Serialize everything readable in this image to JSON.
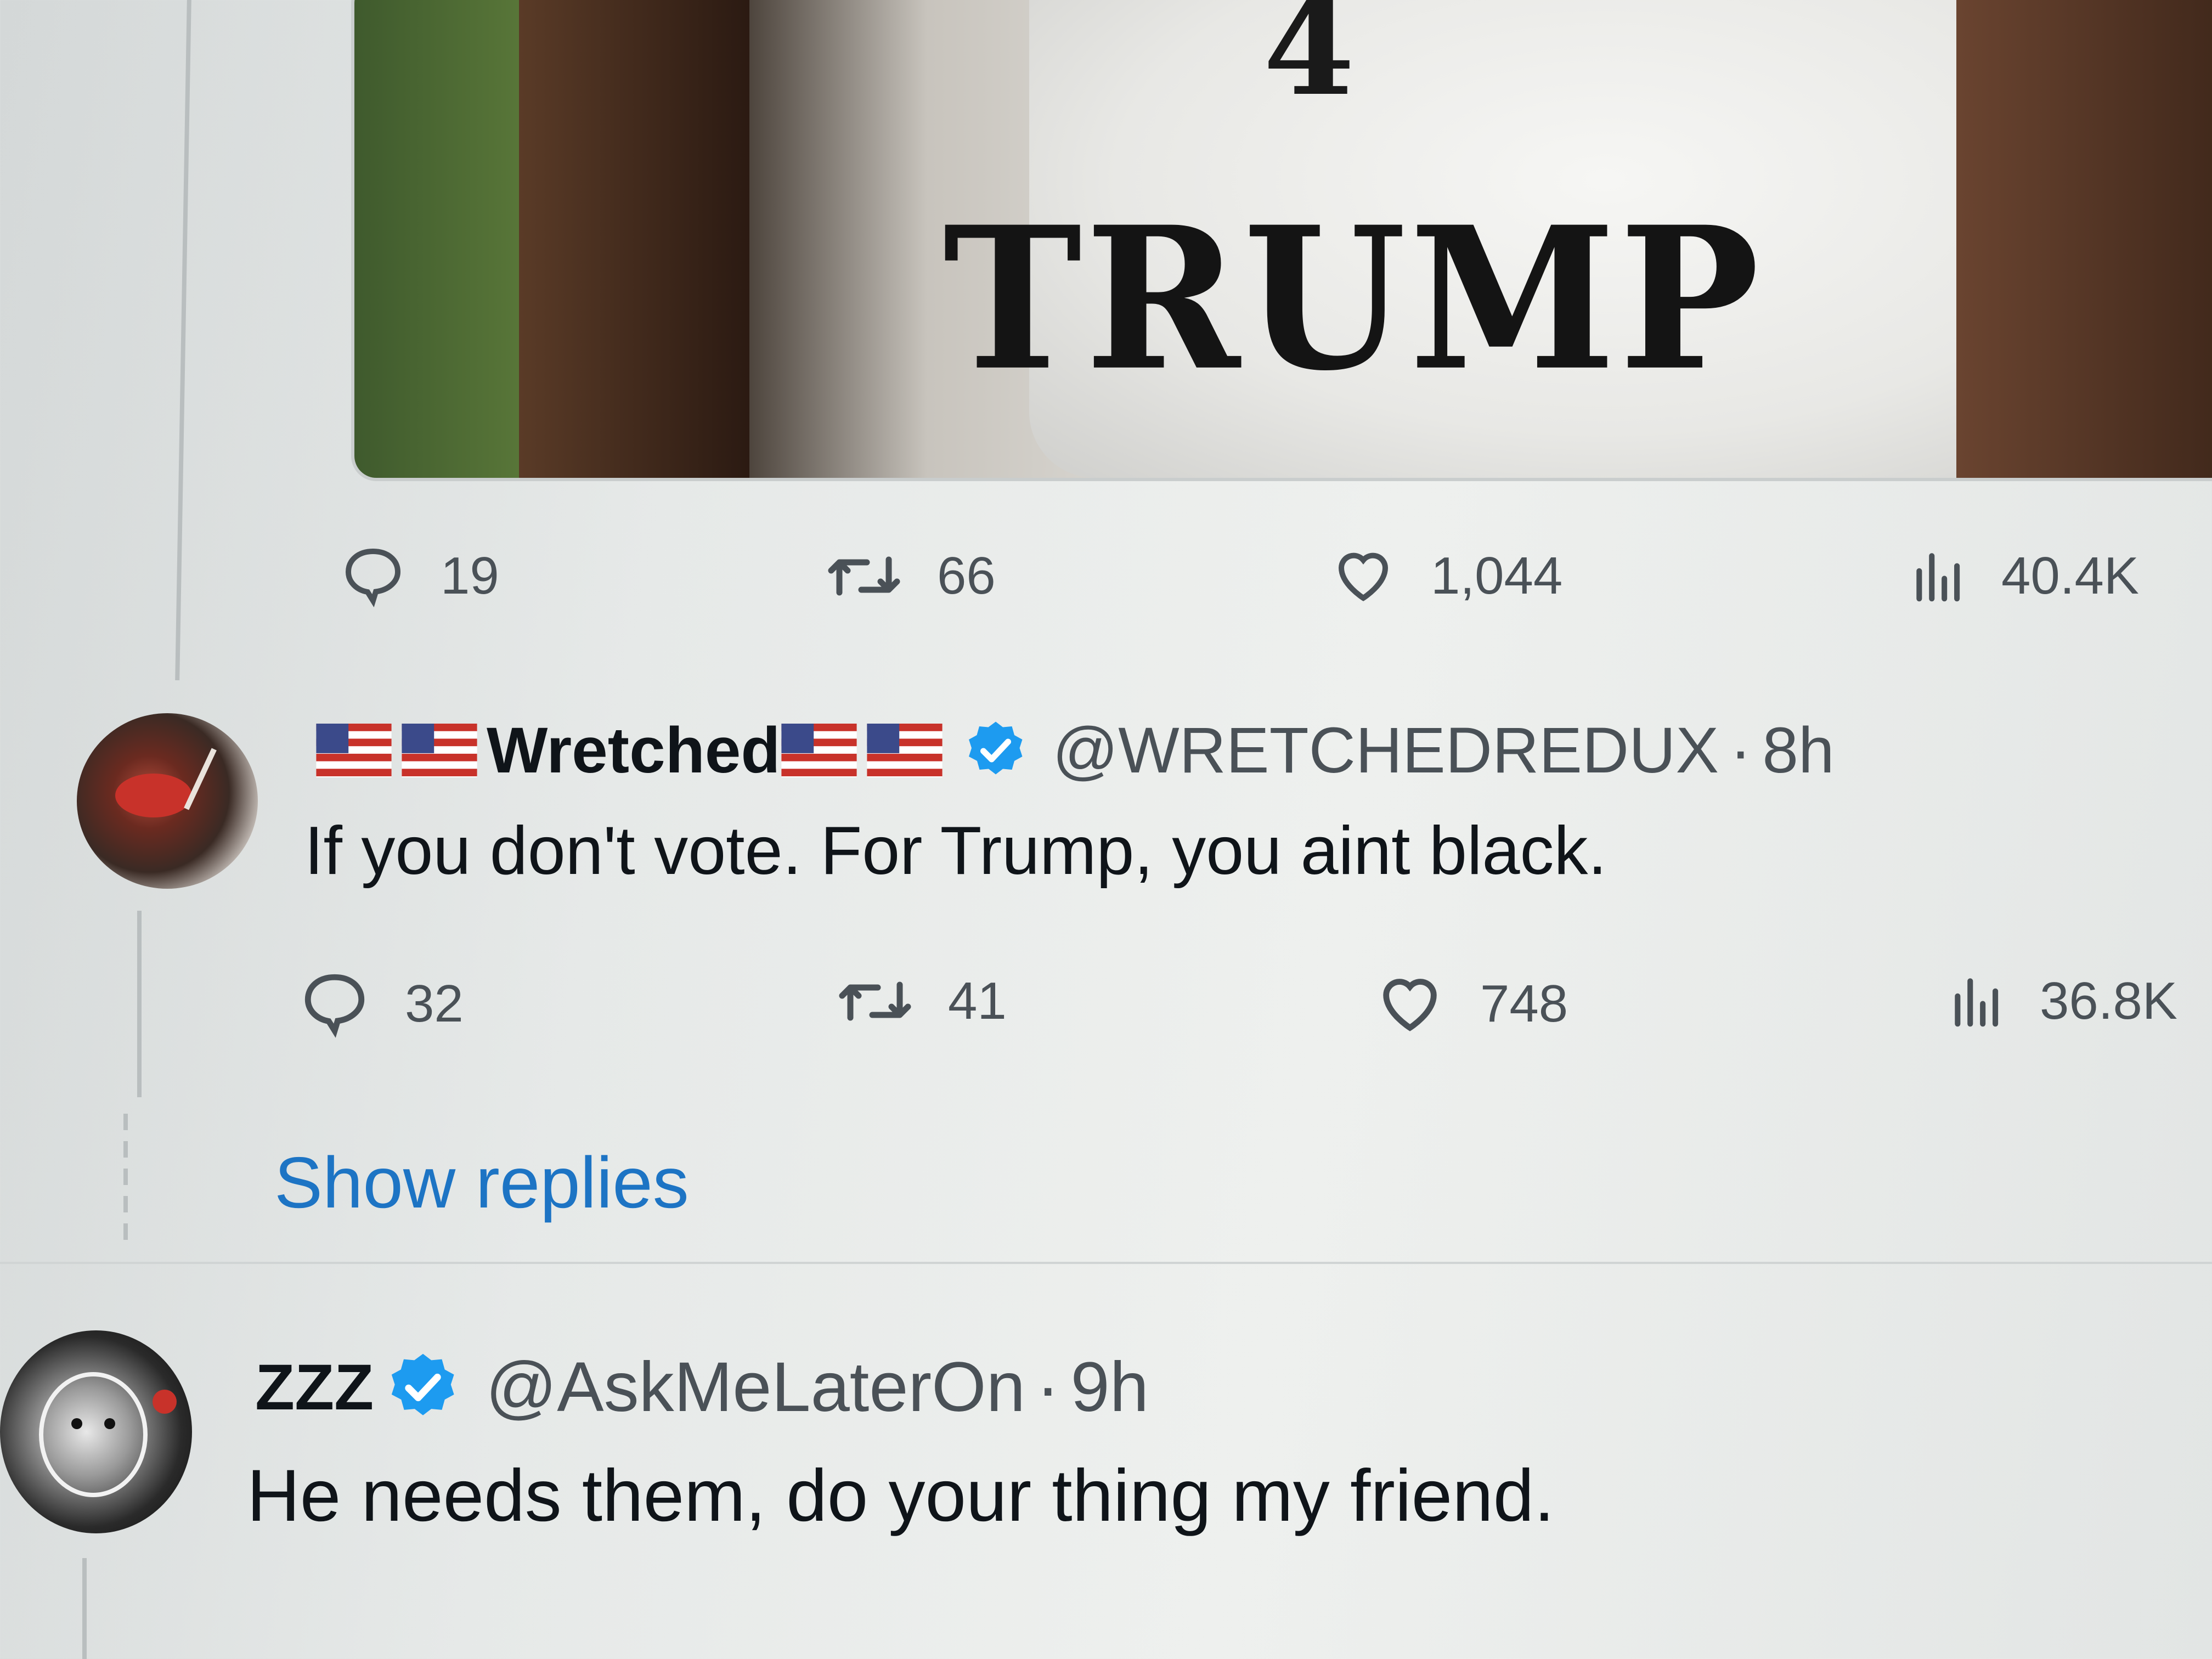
{
  "post": {
    "media": {
      "shirt_number": "4",
      "shirt_text": "TRUMP"
    },
    "actions": {
      "replies": "19",
      "reposts": "66",
      "likes": "1,044",
      "views": "40.4K"
    }
  },
  "reply1": {
    "display_name": "Wretched",
    "handle": "@WRETCHEDREDUX",
    "time": "8h",
    "text": "If you don't vote. For Trump, you aint black.",
    "actions": {
      "replies": "32",
      "reposts": "41",
      "likes": "748",
      "views": "36.8K"
    }
  },
  "show_replies_label": "Show replies",
  "reply2": {
    "display_name": "ZZZ",
    "handle": "@AskMeLaterOn",
    "time": "9h",
    "text": "He needs them, do your thing my friend."
  },
  "colors": {
    "link": "#1d74c4",
    "verified": "#1d9bf0",
    "muted_text": "#4a5157"
  },
  "icons": [
    "reply-icon",
    "repost-icon",
    "like-icon",
    "views-icon",
    "verified-badge-icon",
    "us-flag-icon"
  ]
}
